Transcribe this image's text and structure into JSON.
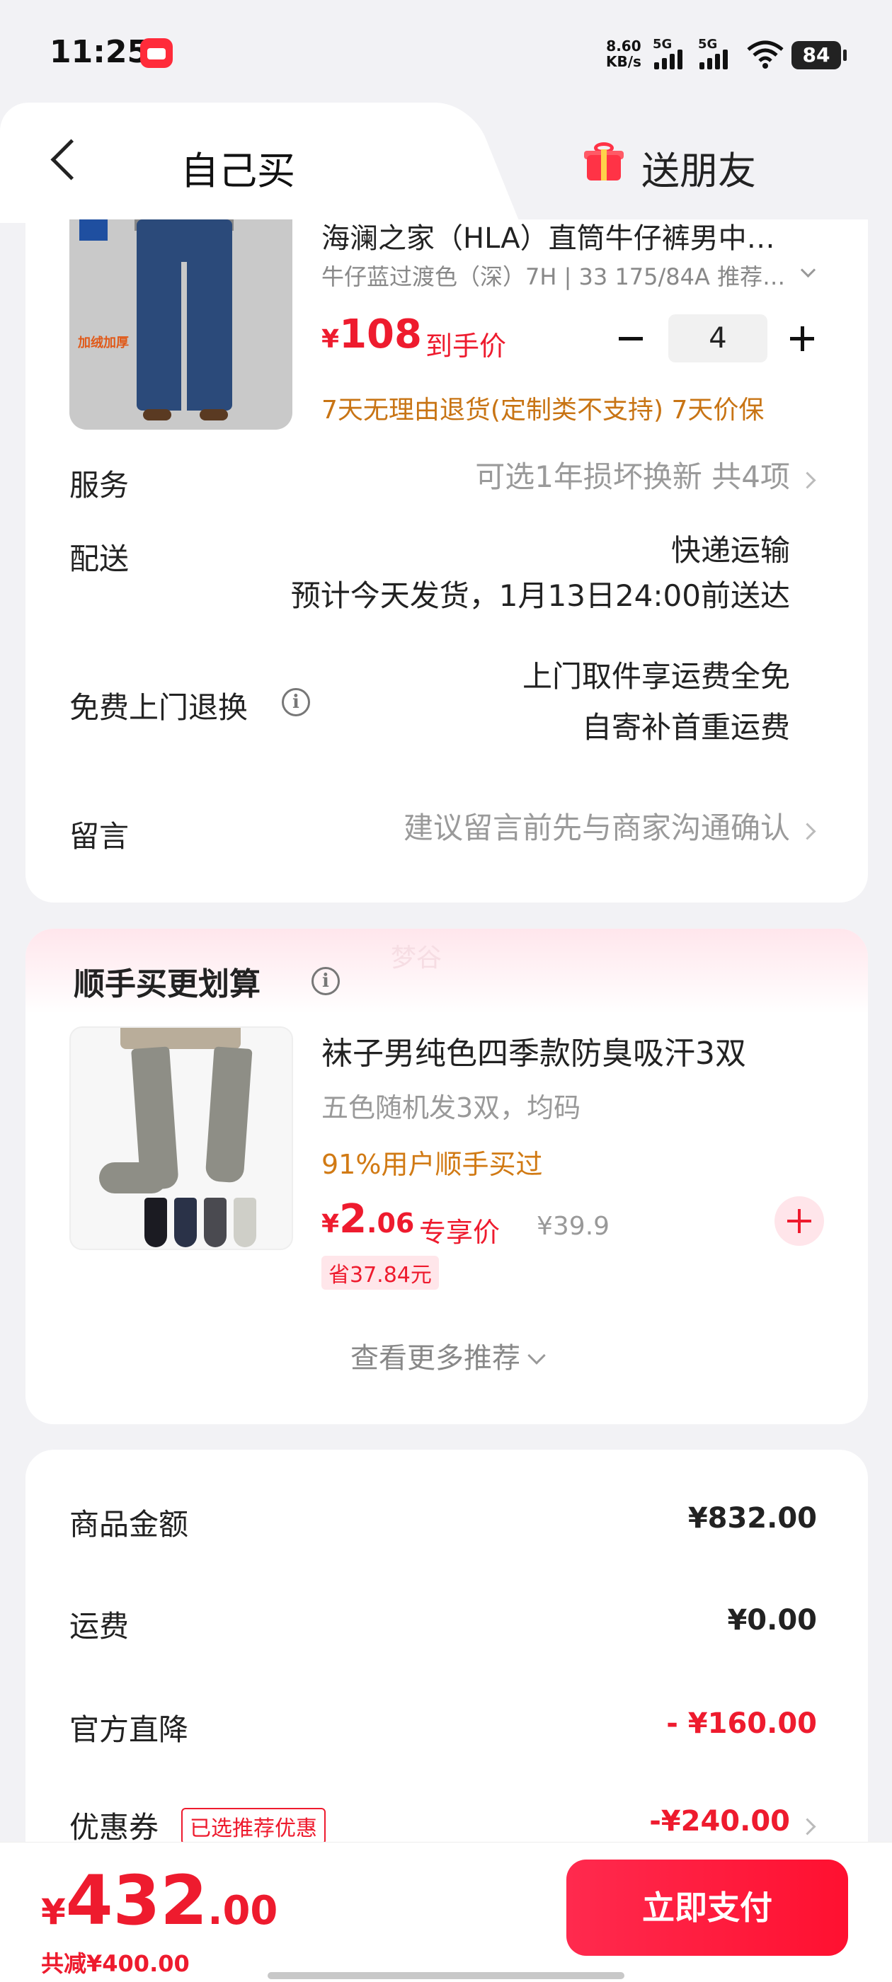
{
  "status_bar": {
    "time": "11:25",
    "net_speed_value": "8.60",
    "net_speed_unit": "KB/s",
    "signal1": "5G",
    "signal2": "5G",
    "battery": "84"
  },
  "header": {
    "tab_self": "自己买",
    "tab_friend": "送朋友"
  },
  "product": {
    "title": "海澜之家（HLA）直筒牛仔裤男中…",
    "spec": "牛仔蓝过渡色（深）7H | 33 175/84A 推荐…",
    "image_tag": "加绒加厚",
    "price_currency": "¥",
    "price": "108",
    "price_label": "到手价",
    "quantity": "4",
    "policy": "7天无理由退货(定制类不支持)  7天价保"
  },
  "rows": {
    "service_label": "服务",
    "service_value": "可选1年损坏换新 共4项",
    "delivery_label": "配送",
    "delivery_method": "快递运输",
    "delivery_eta": "预计今天发货，1月13日24:00前送达",
    "return_label": "免费上门退换",
    "return_line1": "上门取件享运费全免",
    "return_line2": "自寄补首重运费",
    "message_label": "留言",
    "message_placeholder": "建议留言前先与商家沟通确认"
  },
  "addon": {
    "watermark": "梦谷",
    "section_title": "顺手买更划算",
    "title": "袜子男纯色四季款防臭吸汗3双",
    "spec": "五色随机发3双，均码",
    "bought": "91%用户顺手买过",
    "price_currency": "¥",
    "price_int": "2",
    "price_dec": ".06",
    "price_label": "专享价",
    "orig_price": "¥39.9",
    "save": "省37.84元",
    "more": "查看更多推荐"
  },
  "summary": {
    "goods_label": "商品金额",
    "goods_value": "¥832.00",
    "shipping_label": "运费",
    "shipping_value": "¥0.00",
    "discount_label": "官方直降",
    "discount_value": "- ¥160.00",
    "coupon_label": "优惠券",
    "coupon_tag": "已选推荐优惠",
    "coupon_value": "-¥240.00"
  },
  "bottom_bar": {
    "currency": "¥",
    "total_int": "432",
    "total_dec": ".00",
    "saved": "共减¥400.00",
    "pay_button": "立即支付"
  },
  "colors": {
    "accent_red": "#ee1b2e",
    "policy_orange": "#c87414",
    "background": "#f2f2f5"
  }
}
